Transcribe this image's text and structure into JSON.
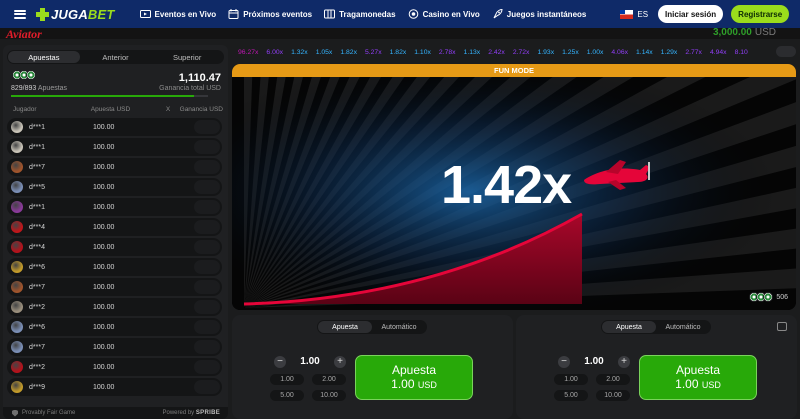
{
  "nav": {
    "brand": {
      "prefix": "JUGA",
      "suffix": "BET"
    },
    "links": [
      {
        "label": "Eventos en Vivo",
        "icon": "live-tv-icon"
      },
      {
        "label": "Próximos eventos",
        "icon": "calendar-icon"
      },
      {
        "label": "Tragamonedas",
        "icon": "slot-machine-icon"
      },
      {
        "label": "Casino en Vivo",
        "icon": "casino-chip-icon"
      },
      {
        "label": "Juegos instantáneos",
        "icon": "rocket-icon"
      }
    ],
    "language": "ES",
    "login_label": "Iniciar sesión",
    "register_label": "Registrarse"
  },
  "game_header": {
    "logo": "Aviator",
    "balance": "3,000.00",
    "currency": "USD"
  },
  "bets_panel": {
    "tabs": [
      "Apuestas",
      "Anterior",
      "Superior"
    ],
    "active_tab": 0,
    "bets_count": "829/893",
    "bets_label": "Apuestas",
    "total_amount": "1,110.47",
    "total_label": "Ganancia total USD",
    "progress_fraction": 0.93,
    "columns": {
      "player": "Jugador",
      "bet": "Apuesta USD",
      "x": "X",
      "win": "Ganancia USD"
    },
    "rows": [
      {
        "name": "d***1",
        "bet": "100.00",
        "avatar_color": "#c9c4b8"
      },
      {
        "name": "d***1",
        "bet": "100.00",
        "avatar_color": "#c9c4b8"
      },
      {
        "name": "d***7",
        "bet": "100.00",
        "avatar_color": "#a0542c"
      },
      {
        "name": "d***5",
        "bet": "100.00",
        "avatar_color": "#7b8fb6"
      },
      {
        "name": "d***1",
        "bet": "100.00",
        "avatar_color": "#8a3a9a"
      },
      {
        "name": "d***4",
        "bet": "100.00",
        "avatar_color": "#c0161a"
      },
      {
        "name": "d***4",
        "bet": "100.00",
        "avatar_color": "#b5121b"
      },
      {
        "name": "d***6",
        "bet": "100.00",
        "avatar_color": "#c29a2a"
      },
      {
        "name": "d***7",
        "bet": "100.00",
        "avatar_color": "#a0542c"
      },
      {
        "name": "d***2",
        "bet": "100.00",
        "avatar_color": "#9a8f7d"
      },
      {
        "name": "d***6",
        "bet": "100.00",
        "avatar_color": "#7b8fb6"
      },
      {
        "name": "d***7",
        "bet": "100.00",
        "avatar_color": "#7b8fb6"
      },
      {
        "name": "d***2",
        "bet": "100.00",
        "avatar_color": "#b5121b"
      },
      {
        "name": "d***9",
        "bet": "100.00",
        "avatar_color": "#c29a2a"
      }
    ],
    "footer_left": "Provably Fair Game",
    "footer_right_prefix": "Powered by",
    "footer_right_brand": "SPRIBE"
  },
  "history": [
    {
      "value": "96.27x",
      "color": "#c017b4"
    },
    {
      "value": "6.00x",
      "color": "#913ef8"
    },
    {
      "value": "1.32x",
      "color": "#34b4ff"
    },
    {
      "value": "1.05x",
      "color": "#34b4ff"
    },
    {
      "value": "1.82x",
      "color": "#34b4ff"
    },
    {
      "value": "5.27x",
      "color": "#913ef8"
    },
    {
      "value": "1.82x",
      "color": "#34b4ff"
    },
    {
      "value": "1.10x",
      "color": "#34b4ff"
    },
    {
      "value": "2.78x",
      "color": "#913ef8"
    },
    {
      "value": "1.13x",
      "color": "#34b4ff"
    },
    {
      "value": "2.42x",
      "color": "#913ef8"
    },
    {
      "value": "2.72x",
      "color": "#913ef8"
    },
    {
      "value": "1.93x",
      "color": "#34b4ff"
    },
    {
      "value": "1.25x",
      "color": "#34b4ff"
    },
    {
      "value": "1.00x",
      "color": "#34b4ff"
    },
    {
      "value": "4.06x",
      "color": "#913ef8"
    },
    {
      "value": "1.14x",
      "color": "#34b4ff"
    },
    {
      "value": "1.29x",
      "color": "#34b4ff"
    },
    {
      "value": "2.77x",
      "color": "#913ef8"
    },
    {
      "value": "4.94x",
      "color": "#913ef8"
    },
    {
      "value": "8.10",
      "color": "#913ef8"
    }
  ],
  "game": {
    "mode_label": "FUN MODE",
    "multiplier": "1.42x",
    "players_online": "506"
  },
  "bet_panels": [
    {
      "tabs": [
        "Apuesta",
        "Automático"
      ],
      "active_tab": 0,
      "amount": "1.00",
      "quick_amounts": [
        "1.00",
        "2.00",
        "5.00",
        "10.00"
      ],
      "button_label": "Apuesta",
      "button_amount": "1.00",
      "button_currency": "USD"
    },
    {
      "tabs": [
        "Apuesta",
        "Automático"
      ],
      "active_tab": 0,
      "amount": "1.00",
      "quick_amounts": [
        "1.00",
        "2.00",
        "5.00",
        "10.00"
      ],
      "button_label": "Apuesta",
      "button_amount": "1.00",
      "button_currency": "USD"
    }
  ],
  "colors": {
    "nav_bg": "#0f2a68",
    "brand_green": "#9bdc1c",
    "fun_mode": "#e69a16",
    "bet_green": "#28a909",
    "aviator_red": "#e11d2b",
    "curve_red": "#e50539"
  }
}
